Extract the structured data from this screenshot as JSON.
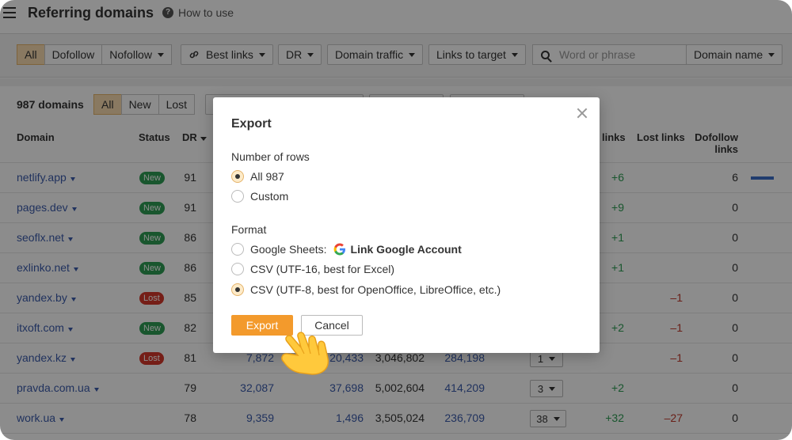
{
  "header": {
    "title": "Referring domains",
    "howto": "How to use"
  },
  "filters": {
    "segments": [
      "All",
      "Dofollow",
      "Nofollow"
    ],
    "best_links": "Best links",
    "dr": "DR",
    "domain_traffic": "Domain traffic",
    "links_to_target": "Links to target",
    "search_placeholder": "Word or phrase",
    "search_scope": "Domain name"
  },
  "results": {
    "count": "987 domains",
    "tabs": [
      "All",
      "New",
      "Lost"
    ]
  },
  "columns": {
    "domain": "Domain",
    "status": "Status",
    "dr": "DR",
    "links": "links",
    "lost_links": "Lost links",
    "dofollow_links": "Dofollow links"
  },
  "rows": [
    {
      "domain": "netlify.app",
      "status": "New",
      "dr": "91",
      "c1": "",
      "c2": "",
      "c3": "",
      "c4": "",
      "sel": "",
      "new": "+6",
      "lost": "",
      "dofollow": "6"
    },
    {
      "domain": "pages.dev",
      "status": "New",
      "dr": "91",
      "c1": "",
      "c2": "",
      "c3": "",
      "c4": "",
      "sel": "",
      "new": "+9",
      "lost": "",
      "dofollow": "0"
    },
    {
      "domain": "seoflx.net",
      "status": "New",
      "dr": "86",
      "c1": "",
      "c2": "",
      "c3": "",
      "c4": "",
      "sel": "",
      "new": "+1",
      "lost": "",
      "dofollow": "0"
    },
    {
      "domain": "exlinko.net",
      "status": "New",
      "dr": "86",
      "c1": "",
      "c2": "",
      "c3": "",
      "c4": "",
      "sel": "",
      "new": "+1",
      "lost": "",
      "dofollow": "0"
    },
    {
      "domain": "yandex.by",
      "status": "Lost",
      "dr": "85",
      "c1": "",
      "c2": "",
      "c3": "",
      "c4": "",
      "sel": "",
      "new": "",
      "lost": "–1",
      "dofollow": "0"
    },
    {
      "domain": "itxoft.com",
      "status": "New",
      "dr": "82",
      "c1": "",
      "c2": "",
      "c3": "",
      "c4": "",
      "sel": "",
      "new": "+2",
      "lost": "–1",
      "dofollow": "0"
    },
    {
      "domain": "yandex.kz",
      "status": "Lost",
      "dr": "81",
      "c1": "7,872",
      "c2": "20,433",
      "c3": "3,046,802",
      "c4": "284,198",
      "sel": "1",
      "new": "",
      "lost": "–1",
      "dofollow": "0"
    },
    {
      "domain": "pravda.com.ua",
      "status": "",
      "dr": "79",
      "c1": "32,087",
      "c2": "37,698",
      "c3": "5,002,604",
      "c4": "414,209",
      "sel": "3",
      "new": "+2",
      "lost": "",
      "dofollow": "0"
    },
    {
      "domain": "work.ua",
      "status": "",
      "dr": "78",
      "c1": "9,359",
      "c2": "1,496",
      "c3": "3,505,024",
      "c4": "236,709",
      "sel": "38",
      "new": "+32",
      "lost": "–27",
      "dofollow": "0"
    }
  ],
  "modal": {
    "title": "Export",
    "rows_label": "Number of rows",
    "row_options": [
      "All 987",
      "Custom"
    ],
    "format_label": "Format",
    "google_sheets": "Google Sheets:",
    "link_google": "Link Google Account",
    "csv16": "CSV (UTF-16, best for Excel)",
    "csv8": "CSV (UTF-8, best for OpenOffice, LibreOffice, etc.)",
    "export": "Export",
    "cancel": "Cancel"
  },
  "colors": {
    "accent": "#f39a2c",
    "link": "#3b5bab",
    "new": "#2e9d54",
    "lost": "#d5372a"
  }
}
